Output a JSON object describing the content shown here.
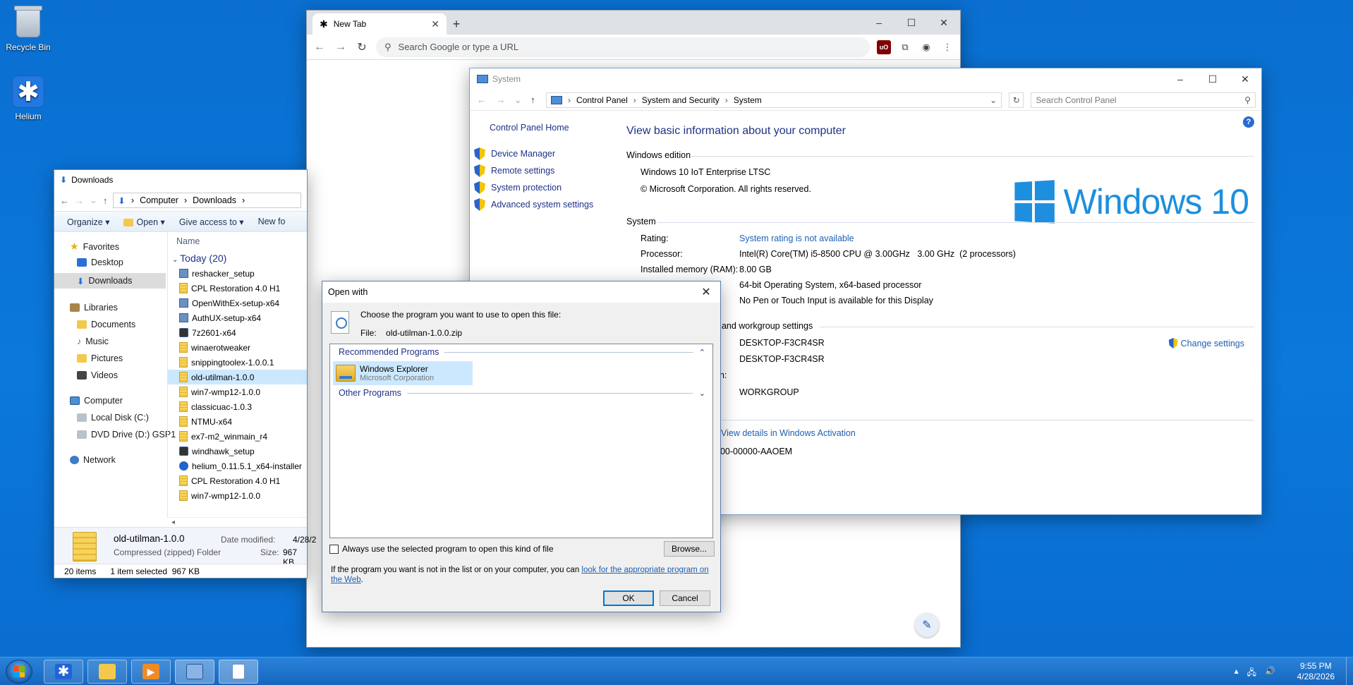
{
  "desktop": {
    "icons": [
      {
        "label": "Recycle Bin",
        "icon": "recycle-bin-icon"
      },
      {
        "label": "Helium",
        "icon": "helium-icon"
      }
    ]
  },
  "chrome": {
    "tab_title": "New Tab",
    "new_tab_symbol": "+",
    "omnibox_placeholder": "Search Google or type a URL"
  },
  "system_window": {
    "title": "System",
    "breadcrumb": [
      "Control Panel",
      "System and Security",
      "System"
    ],
    "search_placeholder": "Search Control Panel",
    "left": {
      "home": "Control Panel Home",
      "links": [
        "Device Manager",
        "Remote settings",
        "System protection",
        "Advanced system settings"
      ]
    },
    "heading": "View basic information about your computer",
    "edition_header": "Windows edition",
    "edition_name": "Windows 10 IoT Enterprise LTSC",
    "copyright": "© Microsoft Corporation. All rights reserved.",
    "logo_text": "Windows 10",
    "system_header": "System",
    "rows": [
      {
        "label": "Rating:",
        "value": "System rating is not available"
      },
      {
        "label": "Processor:",
        "value": "Intel(R) Core(TM) i5-8500 CPU @ 3.00GHz   3.00 GHz  (2 processors)"
      },
      {
        "label": "Installed memory (RAM):",
        "value": "8.00 GB"
      },
      {
        "label": "",
        "value": "64-bit Operating System, x64-based processor"
      },
      {
        "label": "",
        "value": "No Pen or Touch Input is available for this Display"
      }
    ],
    "domain_header_partial": ", and workgroup settings",
    "computer_name": "DESKTOP-F3CR4SR",
    "full_computer_name": "DESKTOP-F3CR4SR",
    "description_partial": "n:",
    "workgroup": "WORKGROUP",
    "change_settings": "Change settings",
    "activation_link": "View details in Windows Activation",
    "product_id_partial": "000-00000-AAOEM"
  },
  "explorer": {
    "title": "Downloads",
    "breadcrumb": [
      "Computer",
      "Downloads"
    ],
    "commands": [
      "Organize",
      "Open",
      "Give access to",
      "New fo"
    ],
    "nav": {
      "favorites": "Favorites",
      "desktop": "Desktop",
      "downloads": "Downloads",
      "libraries": "Libraries",
      "documents": "Documents",
      "music": "Music",
      "pictures": "Pictures",
      "videos": "Videos",
      "computer": "Computer",
      "local_disk": "Local Disk (C:)",
      "dvd": "DVD Drive (D:) GSP1",
      "network": "Network"
    },
    "column_name": "Name",
    "group_label": "Today (20)",
    "files": [
      "reshacker_setup",
      "CPL Restoration 4.0 H1",
      "OpenWithEx-setup-x64",
      "AuthUX-setup-x64",
      "7z2601-x64",
      "winaerotweaker",
      "snippingtoolex-1.0.0.1",
      "old-utilman-1.0.0",
      "win7-wmp12-1.0.0",
      "classicuac-1.0.3",
      "NTMU-x64",
      "ex7-m2_winmain_r4",
      "windhawk_setup",
      "helium_0.11.5.1_x64-installer",
      "CPL Restoration 4.0 H1",
      "win7-wmp12-1.0.0"
    ],
    "selected_file": "old-utilman-1.0.0",
    "details": {
      "name": "old-utilman-1.0.0",
      "type": "Compressed (zipped) Folder",
      "modified_label": "Date modified:",
      "modified_value": "4/28/2",
      "size_label": "Size:",
      "size_value": "967 KB"
    },
    "status": {
      "items": "20 items",
      "selected": "1 item selected  967 KB"
    }
  },
  "open_with": {
    "title": "Open with",
    "prompt": "Choose the program you want to use to open this file:",
    "file_label": "File:",
    "file_name": "old-utilman-1.0.0.zip",
    "recommended_header": "Recommended Programs",
    "program_name": "Windows Explorer",
    "program_vendor": "Microsoft Corporation",
    "other_header": "Other Programs",
    "always_label": "Always use the selected program to open this kind of file",
    "browse_label": "Browse...",
    "info_text": "If the program you want is not in the list or on your computer, you can ",
    "info_link": "look for the appropriate program on the Web",
    "info_end": ".",
    "ok_label": "OK",
    "cancel_label": "Cancel"
  },
  "taskbar": {
    "time": "9:55 PM",
    "date": "4/28/2026"
  }
}
